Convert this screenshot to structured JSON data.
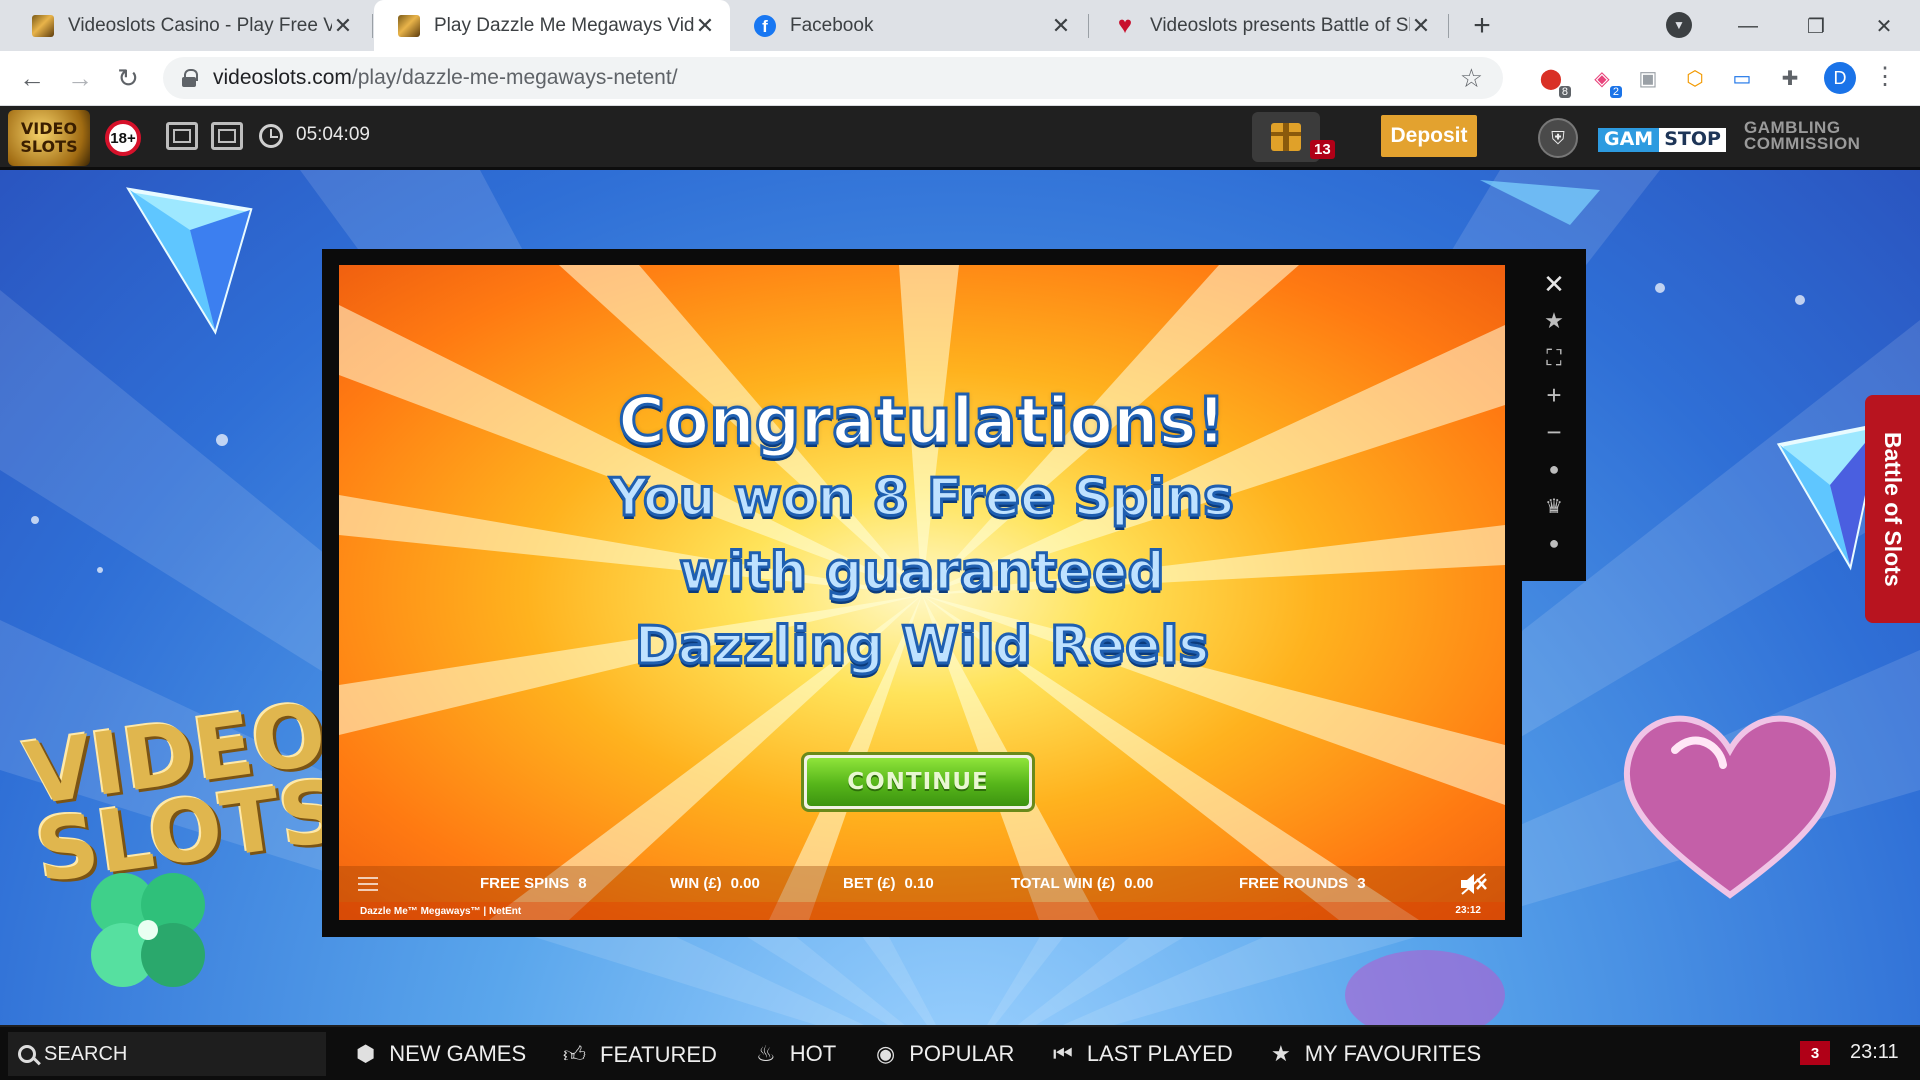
{
  "browser": {
    "tabs": [
      {
        "title": "Videoslots Casino - Play Free Vid",
        "icon": "videoslots-favicon",
        "active": false
      },
      {
        "title": "Play Dazzle Me Megaways Video",
        "icon": "videoslots-favicon",
        "active": true
      },
      {
        "title": "Facebook",
        "icon": "facebook-favicon",
        "active": false
      },
      {
        "title": "Videoslots presents Battle of Slot",
        "icon": "heart-favicon",
        "active": false
      }
    ],
    "url_host": "videoslots.com",
    "url_path": "/play/dazzle-me-megaways-netent/",
    "profile_initial": "D",
    "extension_badges": [
      "8",
      "2"
    ]
  },
  "header": {
    "logo_text": "VIDEO SLOTS",
    "age_label": "18+",
    "session_time": "05:04:09",
    "gift_count": "13",
    "deposit_label": "Deposit",
    "gamstop_left": "GAM",
    "gamstop_right": "STOP",
    "gambling_commission_line1": "GAMBLING",
    "gambling_commission_line2": "COMMISSION"
  },
  "game": {
    "message": {
      "line1": "Congratulations!",
      "line2": "You won 8 Free Spins",
      "line3": "with guaranteed",
      "line4": "Dazzling Wild Reels"
    },
    "continue_label": "CONTINUE",
    "status_bar": {
      "free_spins_label": "FREE SPINS",
      "free_spins_value": "8",
      "win_label": "WIN (£)",
      "win_value": "0.00",
      "bet_label": "BET (£)",
      "bet_value": "0.10",
      "total_win_label": "TOTAL WIN (£)",
      "total_win_value": "0.00",
      "free_rounds_label": "FREE ROUNDS",
      "free_rounds_value": "3"
    },
    "footer_title": "Dazzle Me™ Megaways™ | NetEnt",
    "footer_clock": "23:12"
  },
  "side_panel": {
    "battle_tab_label": "Battle of Slots"
  },
  "background": {
    "logo_text_line1": "VIDEO",
    "logo_text_line2": "SLOTS"
  },
  "bottom_nav": {
    "search_label": "SEARCH",
    "items": [
      {
        "label": "NEW GAMES",
        "icon": "dice-icon"
      },
      {
        "label": "FEATURED",
        "icon": "thumbs-up-icon"
      },
      {
        "label": "HOT",
        "icon": "flame-icon"
      },
      {
        "label": "POPULAR",
        "icon": "chat-icon"
      },
      {
        "label": "LAST PLAYED",
        "icon": "rewind-icon"
      },
      {
        "label": "MY FAVOURITES",
        "icon": "star-icon"
      }
    ],
    "notification_count": "3",
    "clock": "23:11"
  },
  "colors": {
    "deposit": "#e3a22f",
    "battle_tab": "#b8141f",
    "continue_green": "#56b51a",
    "alert_red": "#b00017"
  }
}
